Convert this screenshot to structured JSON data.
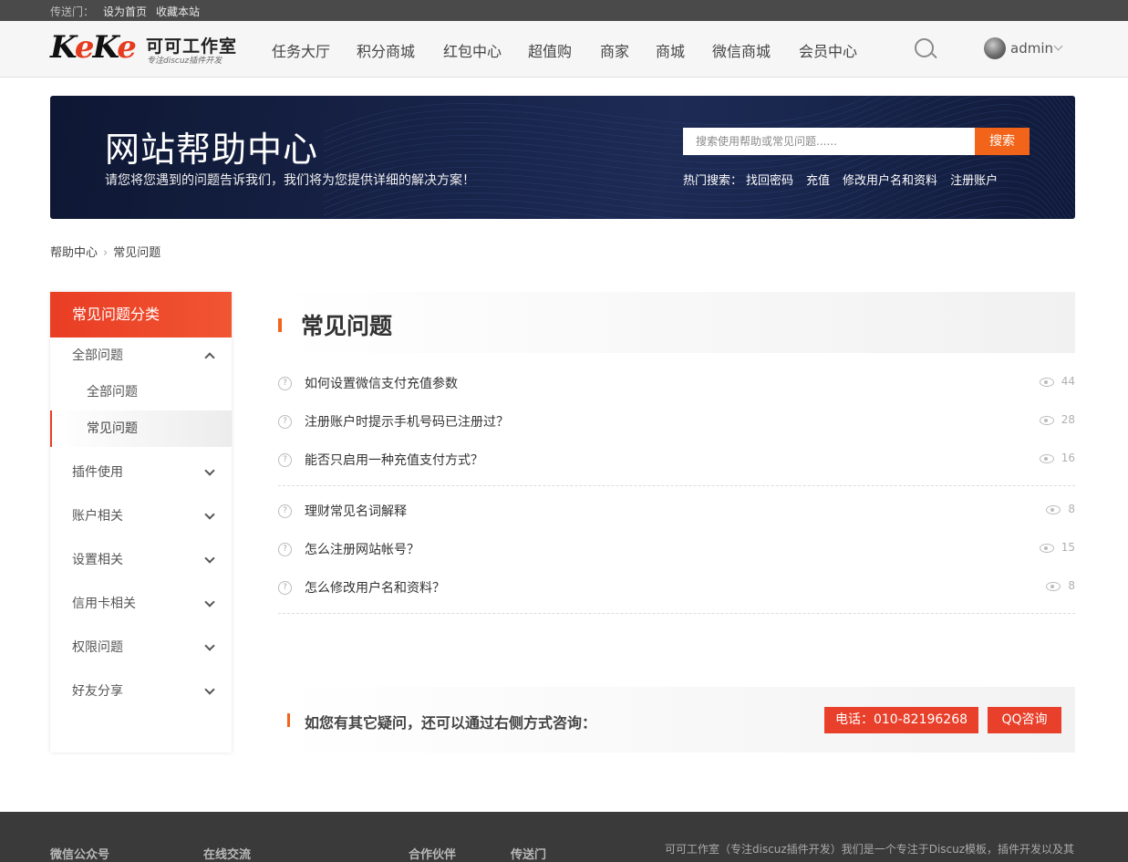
{
  "topbar": {
    "label": "传送门：",
    "links": [
      "设为首页",
      "收藏本站"
    ]
  },
  "header": {
    "logo": {
      "mark": "KeKe",
      "name": "可可工作室",
      "tagline": "专注discuz插件开发"
    },
    "nav": [
      "任务大厅",
      "积分商城",
      "红包中心",
      "超值购",
      "商家",
      "商城",
      "微信商城",
      "会员中心"
    ],
    "user": "admin"
  },
  "banner": {
    "title": "网站帮助中心",
    "desc": "请您将您遇到的问题告诉我们，我们将为您提供详细的解决方案！",
    "search_placeholder": "搜索使用帮助或常见问题......",
    "search_btn": "搜索",
    "hot_label": "热门搜索：",
    "hot": [
      "找回密码",
      "充值",
      "修改用户名和资料",
      "注册账户"
    ]
  },
  "breadcrumb": {
    "home": "帮助中心",
    "sep": "›",
    "current": "常见问题"
  },
  "sidebar": {
    "header": "常见问题分类",
    "groups": [
      {
        "label": "全部问题",
        "expanded": true,
        "subs": [
          "全部问题",
          "常见问题"
        ]
      },
      {
        "label": "插件使用"
      },
      {
        "label": "账户相关"
      },
      {
        "label": "设置相关"
      },
      {
        "label": "信用卡相关"
      },
      {
        "label": "权限问题"
      },
      {
        "label": "好友分享"
      }
    ],
    "active_sub": "常见问题"
  },
  "main": {
    "title": "常见问题",
    "questions": [
      {
        "title": "如何设置微信支付充值参数",
        "views": "44"
      },
      {
        "title": "注册账户时提示手机号码已注册过？",
        "views": "28"
      },
      {
        "title": "能否只启用一种充值支付方式？",
        "views": "16"
      },
      {
        "title": "理财常见名词解释",
        "views": "8"
      },
      {
        "title": "怎么注册网站帐号？",
        "views": "15"
      },
      {
        "title": "怎么修改用户名和资料？",
        "views": "8"
      }
    ]
  },
  "contact": {
    "text": "如您有其它疑问，还可以通过右侧方式咨询：",
    "phone": "电话：010-82196268",
    "qq": "QQ咨询"
  },
  "footer": {
    "cols": [
      "微信公众号",
      "在线交流",
      "合作伙伴",
      "传送门"
    ],
    "about": "可可工作室（专注discuz插件开发）我们是一个专注于Discuz模板，插件开发以及其"
  },
  "colors": {
    "accent": "#e93d24",
    "orange": "#f26419",
    "banner": "#18244a",
    "footer": "#3a3a3a"
  }
}
